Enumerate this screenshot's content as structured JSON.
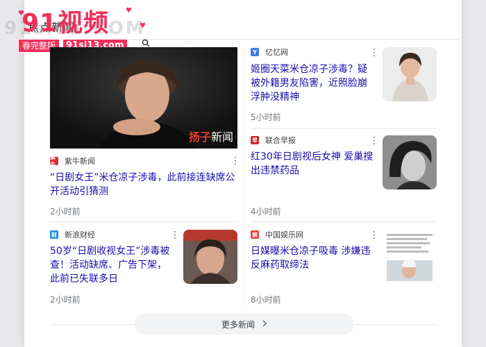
{
  "section": {
    "title": "焦点新闻"
  },
  "brand": {
    "title": "91视频",
    "ghost_text": "91si13.COM",
    "badge": "春完整版",
    "url": "91si13.com"
  },
  "colors": {
    "brand": "#f0305a",
    "link": "#1a0dab",
    "meta": "#70757a"
  },
  "articles": [
    {
      "source": "紫牛新闻",
      "source_icon": "紫牛",
      "source_color": "#d32f2f",
      "headline": "“日剧女王”米仓凉子涉毒，此前接连缺席公开活动引猜测",
      "time": "2小时前",
      "image_watermark": "新闻",
      "image_watermark_brand": "扬子"
    },
    {
      "source": "亿忆网",
      "source_icon": "Y",
      "source_color": "#3f7de0",
      "headline": "姬圈天菜米仓凉子涉毒？疑被外籍男友陷害，近照脸崩浮肿没精神",
      "time": "5小时前"
    },
    {
      "source": "联合早报",
      "source_icon": "早",
      "source_color": "#c62828",
      "headline": "红30年日剧视后女神 爱巢搜出违禁药品",
      "time": "4小时前"
    },
    {
      "source": "新浪财经",
      "source_icon": "财",
      "source_color": "#1e88e5",
      "headline": "50岁“日剧收视女王”涉毒被查！活动缺席、广告下架，此前已失联多日",
      "time": "2小时前"
    },
    {
      "source": "中国娱乐网",
      "source_icon": "娱",
      "source_color": "#e53935",
      "headline": "日媒曝米仓凉子吸毒 涉嫌违反麻药取缔法",
      "time": "8小时前"
    }
  ],
  "more_button": {
    "label": "更多新闻"
  },
  "icons": {
    "more": "more-vert-icon",
    "chevron": "chevron-right-icon",
    "search": "search-icon",
    "cursor": "hand-cursor-icon"
  }
}
